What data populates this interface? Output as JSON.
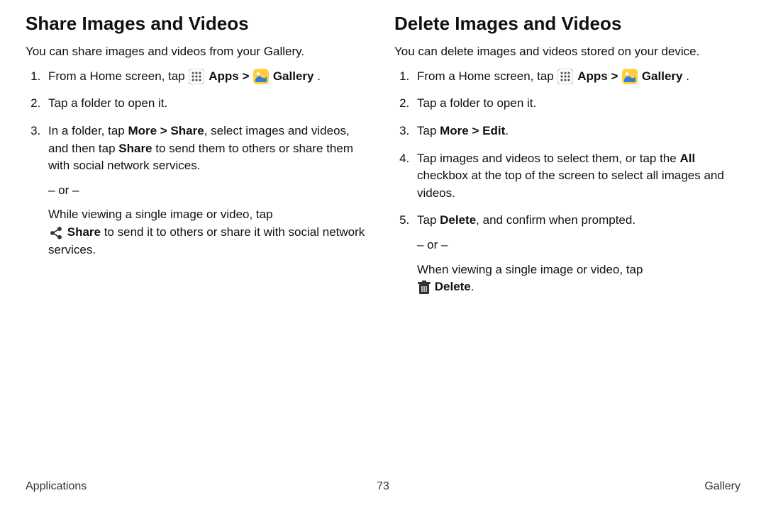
{
  "left": {
    "heading": "Share Images and Videos",
    "intro": "You can share images and videos from your Gallery.",
    "step1_a": "From a Home screen, tap ",
    "apps_label": "Apps",
    "chevron": " > ",
    "gallery_label": "Gallery",
    "period": " .",
    "step2": "Tap a folder to open it.",
    "step3_a": "In a folder, tap ",
    "step3_more_share": "More > Share",
    "step3_b": ", select images and videos, and then tap ",
    "step3_share": "Share",
    "step3_c": " to send them to others or share them with social network services.",
    "or": "– or –",
    "step3_d": "While viewing a single image or video, tap ",
    "share_icon_label": "Share",
    "step3_e": "  to send it to others or share it with social network services."
  },
  "right": {
    "heading": "Delete Images and Videos",
    "intro": "You can delete images and videos stored on your device.",
    "step1_a": "From a Home screen, tap ",
    "apps_label": "Apps",
    "chevron": "  > ",
    "gallery_label": "Gallery",
    "period": " .",
    "step2": "Tap a folder to open it.",
    "step3_a": "Tap ",
    "step3_more_edit": "More > Edit",
    "step3_b": ".",
    "step4_a": "Tap images and videos to select them, or tap the ",
    "step4_all": "All",
    "step4_b": " checkbox at the top of the screen to select all images and videos.",
    "step5_a": "Tap ",
    "step5_delete": "Delete",
    "step5_b": ", and confirm when prompted.",
    "or": "– or –",
    "step5_c": "When viewing a single image or video, tap ",
    "delete_icon_label": "Delete",
    "step5_d": "."
  },
  "footer": {
    "left": "Applications",
    "center": "73",
    "right": "Gallery"
  }
}
